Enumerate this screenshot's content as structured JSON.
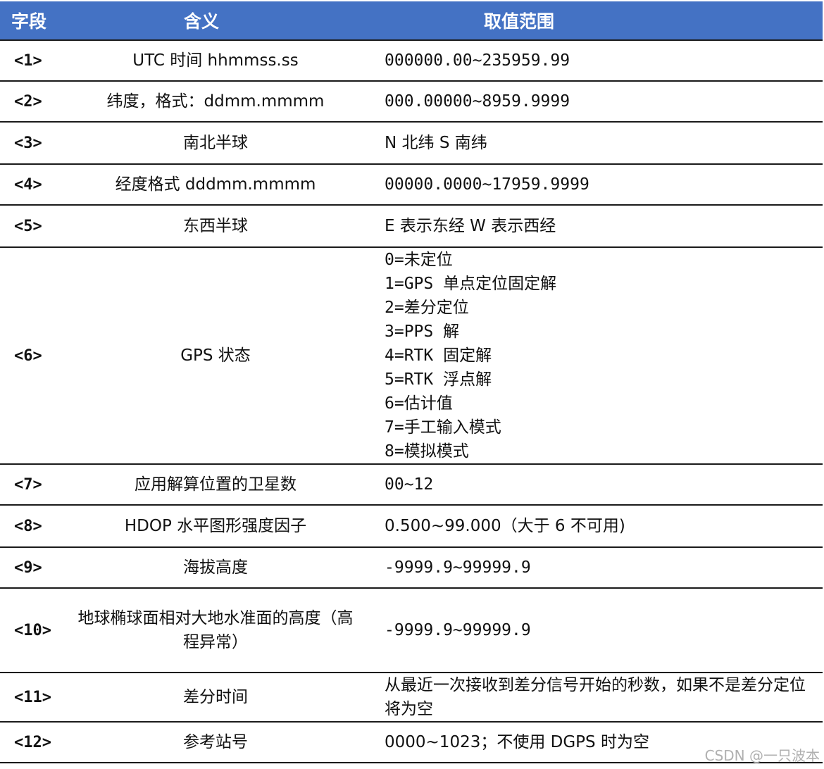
{
  "table": {
    "headers": [
      "字段",
      "含义",
      "取值范围"
    ],
    "rows": [
      {
        "field": "<1>",
        "meaning": "UTC 时间 hhmmss.ss",
        "range": [
          "000000.00~235959.99"
        ]
      },
      {
        "field": "<2>",
        "meaning": "纬度，格式：ddmm.mmmm",
        "range": [
          "000.00000~8959.9999"
        ]
      },
      {
        "field": "<3>",
        "meaning": "南北半球",
        "range": [
          "N 北纬  S 南纬"
        ]
      },
      {
        "field": "<4>",
        "meaning": "经度格式 dddmm.mmmm",
        "range": [
          "00000.0000~17959.9999"
        ]
      },
      {
        "field": "<5>",
        "meaning": "东西半球",
        "range": [
          "E 表示东经  W 表示西经"
        ]
      },
      {
        "field": "<6>",
        "meaning": "GPS 状态",
        "range": [
          "0=未定位",
          "1=GPS 单点定位固定解",
          "2=差分定位",
          "3=PPS 解",
          "4=RTK 固定解",
          "5=RTK 浮点解",
          "6=估计值",
          "7=手工输入模式",
          "8=模拟模式"
        ]
      },
      {
        "field": "<7>",
        "meaning": "应用解算位置的卫星数",
        "range": [
          "00~12"
        ]
      },
      {
        "field": "<8>",
        "meaning": "HDOP  水平图形强度因子",
        "range": [
          "0.500~99.000（大于 6 不可用)"
        ]
      },
      {
        "field": "<9>",
        "meaning": "海拔高度",
        "range": [
          "-9999.9~99999.9"
        ]
      },
      {
        "field": "<10>",
        "meaning": "地球椭球面相对大地水准面的高度（高程异常）",
        "range": [
          "-9999.9~99999.9"
        ]
      },
      {
        "field": "<11>",
        "meaning": "差分时间",
        "range": [
          "从最近一次接收到差分信号开始的秒数，如果不是差分定位将为空"
        ]
      },
      {
        "field": "<12>",
        "meaning": "参考站号",
        "range": [
          "0000~1023；不使用 DGPS 时为空"
        ]
      }
    ]
  },
  "watermark": "CSDN @一只波本"
}
